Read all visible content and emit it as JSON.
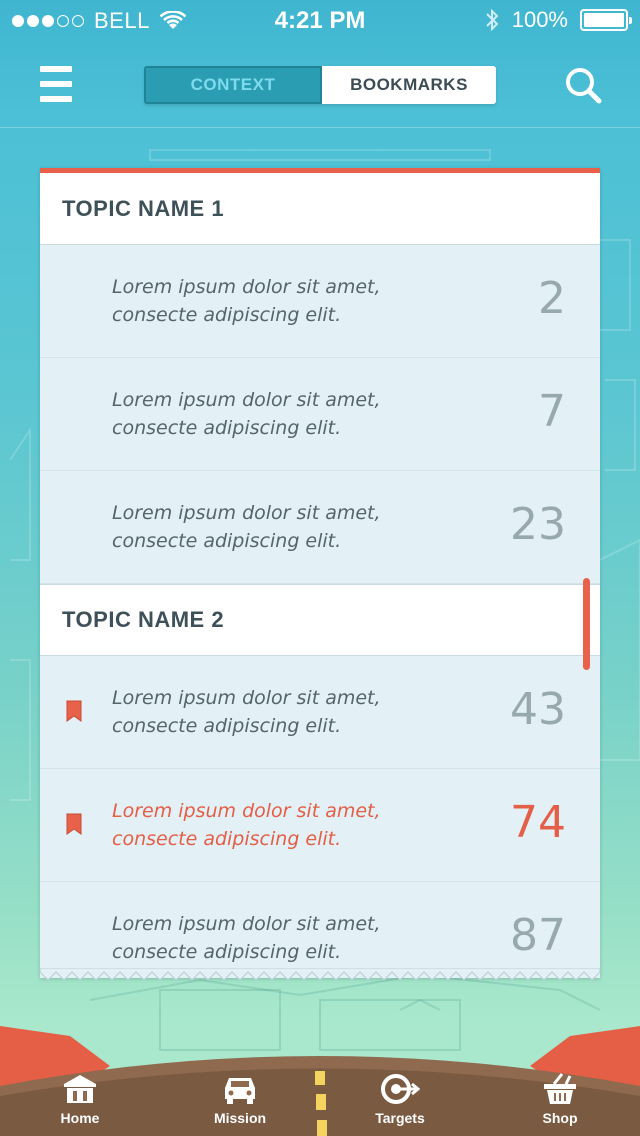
{
  "status_bar": {
    "carrier": "BELL",
    "time": "4:21 PM",
    "battery": "100%",
    "signal_bars": 3,
    "signal_total": 5,
    "icons": [
      "wifi-icon",
      "bluetooth-icon",
      "battery-icon"
    ]
  },
  "nav": {
    "menu_icon": "hamburger-menu-icon",
    "tabs": [
      {
        "label": "CONTEXT",
        "active": true
      },
      {
        "label": "BOOKMARKS",
        "active": false
      }
    ],
    "search_icon": "search-icon"
  },
  "topics": [
    {
      "title": "TOPIC NAME 1",
      "items": [
        {
          "text": "Lorem ipsum dolor sit amet, consecte adipiscing elit.",
          "count": "2",
          "bookmarked": false,
          "highlighted": false
        },
        {
          "text": "Lorem ipsum dolor sit amet, consecte adipiscing elit.",
          "count": "7",
          "bookmarked": false,
          "highlighted": false
        },
        {
          "text": "Lorem ipsum dolor sit amet, consecte adipiscing elit.",
          "count": "23",
          "bookmarked": false,
          "highlighted": false
        }
      ]
    },
    {
      "title": "TOPIC NAME 2",
      "items": [
        {
          "text": "Lorem ipsum dolor sit amet, consecte adipiscing elit.",
          "count": "43",
          "bookmarked": true,
          "highlighted": false
        },
        {
          "text": "Lorem ipsum dolor sit amet, consecte adipiscing elit.",
          "count": "74",
          "bookmarked": true,
          "highlighted": true
        },
        {
          "text": "Lorem ipsum dolor sit amet, consecte adipiscing elit.",
          "count": "87",
          "bookmarked": false,
          "highlighted": false
        }
      ]
    }
  ],
  "tab_bar": [
    {
      "label": "Home",
      "icon": "home-icon"
    },
    {
      "label": "Mission",
      "icon": "car-icon"
    },
    {
      "label": "Targets",
      "icon": "target-icon"
    },
    {
      "label": "Shop",
      "icon": "basket-icon"
    }
  ],
  "colors": {
    "accent": "#e8614a",
    "segment_active": "#2a9db3",
    "text_dark": "#3e5058",
    "card_bg": "#e3f0f5"
  }
}
